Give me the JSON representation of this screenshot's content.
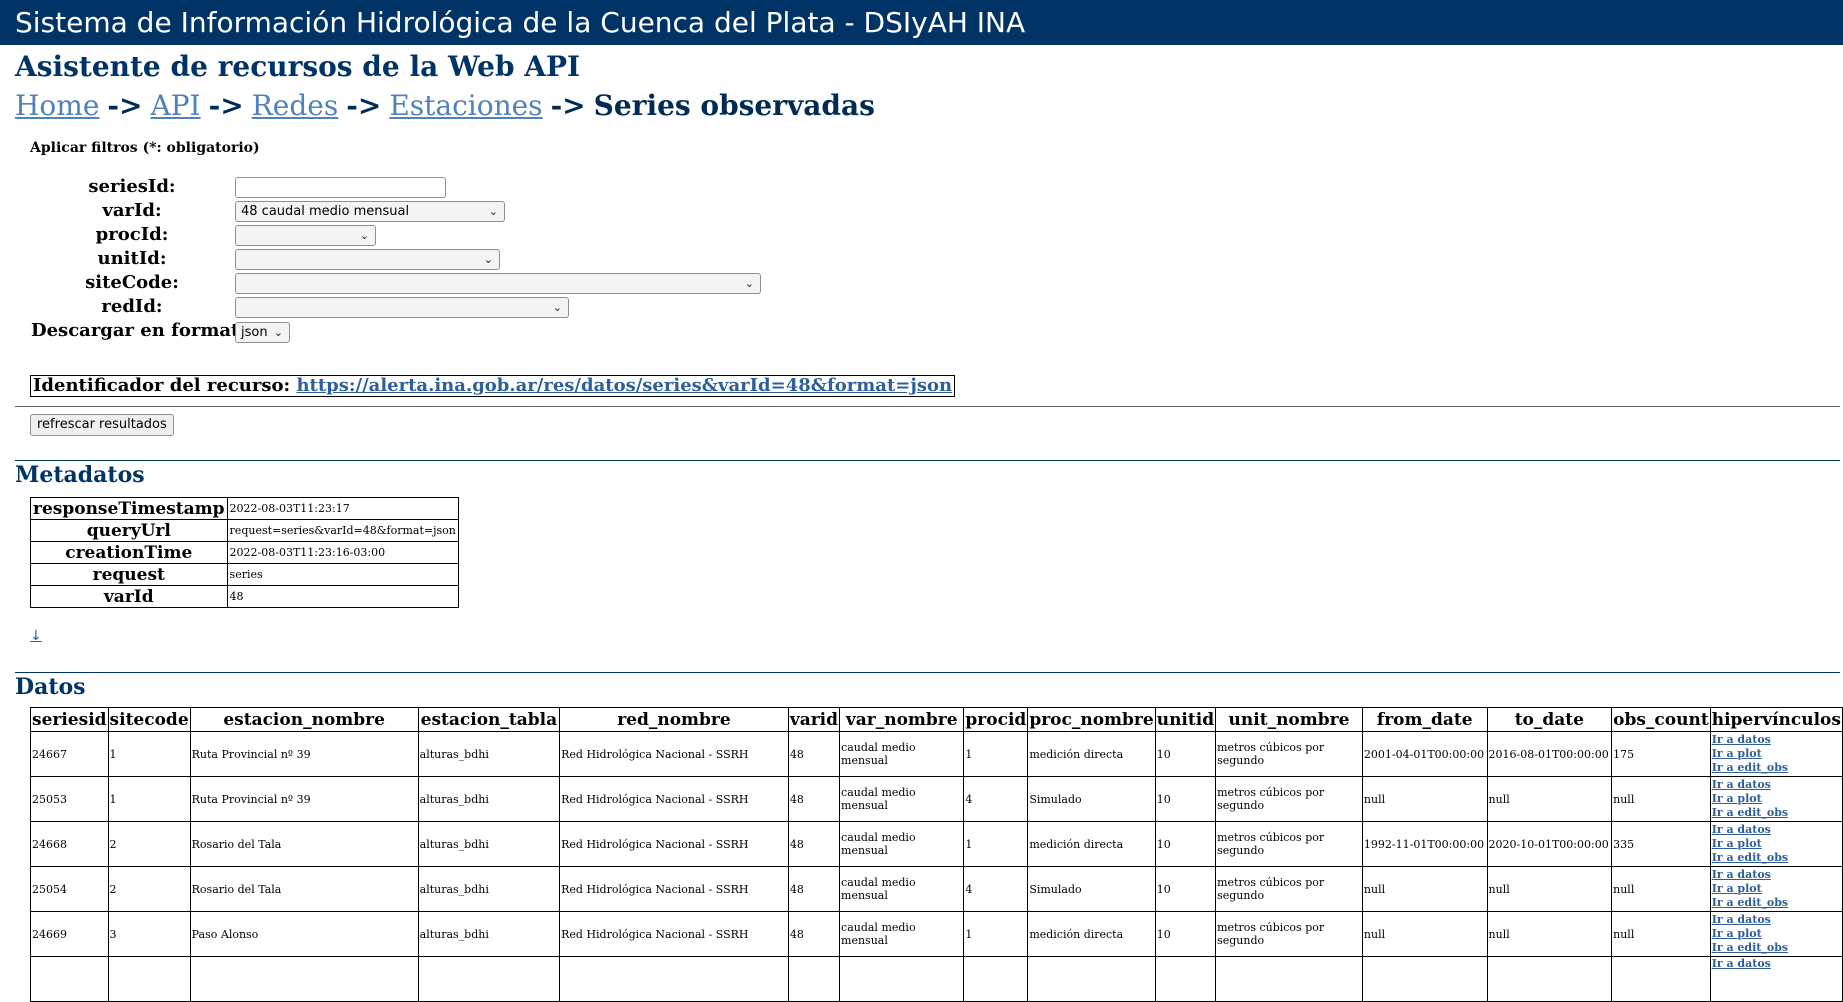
{
  "header": {
    "title": "Sistema de Información Hidrológica de la Cuenca del Plata - DSIyAH INA"
  },
  "page": {
    "title": "Asistente de recursos de la Web API"
  },
  "breadcrumb": {
    "items": [
      "Home",
      "API",
      "Redes",
      "Estaciones"
    ],
    "separator": "->",
    "current": "Series observadas"
  },
  "filters": {
    "title": "Aplicar filtros (*: obligatorio)",
    "seriesId": {
      "label": "seriesId:",
      "value": ""
    },
    "varId": {
      "label": "varId:",
      "value": "48 caudal medio mensual"
    },
    "procId": {
      "label": "procId:",
      "value": ""
    },
    "unitId": {
      "label": "unitId:",
      "value": ""
    },
    "siteCode": {
      "label": "siteCode:",
      "value": ""
    },
    "redId": {
      "label": "redId:",
      "value": ""
    },
    "format": {
      "label": "Descargar en formato:",
      "value": "json"
    }
  },
  "resource": {
    "label": "Identificador del recurso:",
    "url": "https://alerta.ina.gob.ar/res/datos/series&varId=48&format=json"
  },
  "refresh_button": "refrescar resultados",
  "metadata": {
    "title": "Metadatos",
    "rows": [
      {
        "key": "responseTimestamp",
        "value": "2022-08-03T11:23:17"
      },
      {
        "key": "queryUrl",
        "value": "request=series&varId=48&format=json"
      },
      {
        "key": "creationTime",
        "value": "2022-08-03T11:23:16-03:00"
      },
      {
        "key": "request",
        "value": "series"
      },
      {
        "key": "varId",
        "value": "48"
      }
    ],
    "download_link": "↓"
  },
  "datos": {
    "title": "Datos",
    "columns": [
      "seriesid",
      "sitecode",
      "estacion_nombre",
      "estacion_tabla",
      "red_nombre",
      "varid",
      "var_nombre",
      "procid",
      "proc_nombre",
      "unitid",
      "unit_nombre",
      "from_date",
      "to_date",
      "obs_count",
      "hipervínculos"
    ],
    "link_labels": [
      "Ir a datos",
      "Ir a plot",
      "Ir a edit_obs"
    ],
    "rows": [
      {
        "seriesid": "24667",
        "sitecode": "1",
        "estacion_nombre": "Ruta Provincial nº 39",
        "estacion_tabla": "alturas_bdhi",
        "red_nombre": "Red Hidrológica Nacional - SSRH",
        "varid": "48",
        "var_nombre": "caudal medio mensual",
        "procid": "1",
        "proc_nombre": "medición directa",
        "unitid": "10",
        "unit_nombre": "metros cúbicos por segundo",
        "from_date": "2001-04-01T00:00:00",
        "to_date": "2016-08-01T00:00:00",
        "obs_count": "175"
      },
      {
        "seriesid": "25053",
        "sitecode": "1",
        "estacion_nombre": "Ruta Provincial nº 39",
        "estacion_tabla": "alturas_bdhi",
        "red_nombre": "Red Hidrológica Nacional - SSRH",
        "varid": "48",
        "var_nombre": "caudal medio mensual",
        "procid": "4",
        "proc_nombre": "Simulado",
        "unitid": "10",
        "unit_nombre": "metros cúbicos por segundo",
        "from_date": "null",
        "to_date": "null",
        "obs_count": "null"
      },
      {
        "seriesid": "24668",
        "sitecode": "2",
        "estacion_nombre": "Rosario del Tala",
        "estacion_tabla": "alturas_bdhi",
        "red_nombre": "Red Hidrológica Nacional - SSRH",
        "varid": "48",
        "var_nombre": "caudal medio mensual",
        "procid": "1",
        "proc_nombre": "medición directa",
        "unitid": "10",
        "unit_nombre": "metros cúbicos por segundo",
        "from_date": "1992-11-01T00:00:00",
        "to_date": "2020-10-01T00:00:00",
        "obs_count": "335"
      },
      {
        "seriesid": "25054",
        "sitecode": "2",
        "estacion_nombre": "Rosario del Tala",
        "estacion_tabla": "alturas_bdhi",
        "red_nombre": "Red Hidrológica Nacional - SSRH",
        "varid": "48",
        "var_nombre": "caudal medio mensual",
        "procid": "4",
        "proc_nombre": "Simulado",
        "unitid": "10",
        "unit_nombre": "metros cúbicos por segundo",
        "from_date": "null",
        "to_date": "null",
        "obs_count": "null"
      },
      {
        "seriesid": "24669",
        "sitecode": "3",
        "estacion_nombre": "Paso Alonso",
        "estacion_tabla": "alturas_bdhi",
        "red_nombre": "Red Hidrológica Nacional - SSRH",
        "varid": "48",
        "var_nombre": "caudal medio mensual",
        "procid": "1",
        "proc_nombre": "medición directa",
        "unitid": "10",
        "unit_nombre": "metros cúbicos por segundo",
        "from_date": "null",
        "to_date": "null",
        "obs_count": "null"
      }
    ],
    "partial_row_link": "Ir a datos"
  },
  "colors": {
    "header_bg": "#003366",
    "heading": "#003366",
    "link": "#4f81bd"
  }
}
